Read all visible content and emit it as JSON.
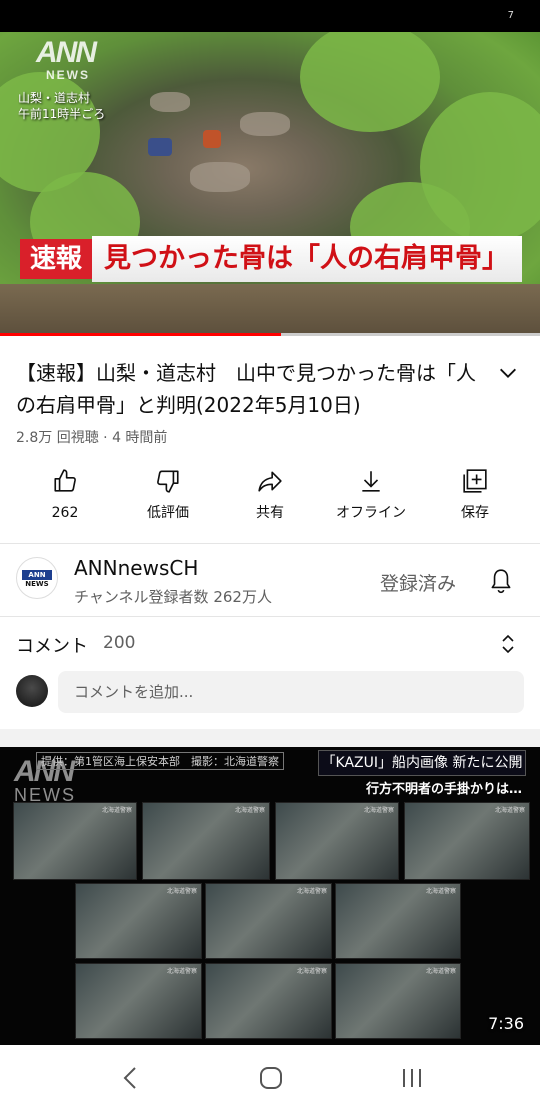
{
  "status_bar": {
    "signal_text": "7"
  },
  "video": {
    "logo": "ANN",
    "logo_sub": "NEWS",
    "location_line1": "山梨・道志村",
    "location_line2": "午前11時半ごろ",
    "breaking_label": "速報",
    "breaking_headline": "見つかった骨は「人の右肩甲骨」",
    "progress": 0.52
  },
  "title": "【速報】山梨・道志村　山中で見つかった骨は「人の右肩甲骨」と判明(2022年5月10日)",
  "meta": "2.8万 回視聴 · 4 時間前",
  "actions": [
    {
      "label": "262",
      "icon": "thumbs-up-icon"
    },
    {
      "label": "低評価",
      "icon": "thumbs-down-icon"
    },
    {
      "label": "共有",
      "icon": "share-icon"
    },
    {
      "label": "オフライン",
      "icon": "download-icon"
    },
    {
      "label": "保存",
      "icon": "save-playlist-icon"
    }
  ],
  "channel": {
    "name": "ANNnewsCH",
    "subscribers": "チャンネル登録者数 262万人",
    "subscribed_label": "登録済み",
    "avatar_top": "ANN",
    "avatar_bottom": "NEWS"
  },
  "comments": {
    "label": "コメント",
    "count": "200",
    "placeholder": "コメントを追加..."
  },
  "next_video": {
    "credit": "提供：第1管区海上保安本部　撮影：北海道警察",
    "headline": "「KAZUⅠ」船内画像 新たに公開",
    "subheadline": "行方不明者の手掛かりは…",
    "logo": "ANN",
    "logo_sub": "NEWS",
    "thumb_tag": "北海道警察",
    "duration": "7:36"
  },
  "nav": {
    "back": "back-icon",
    "home": "home-icon",
    "recents": "recents-icon"
  }
}
